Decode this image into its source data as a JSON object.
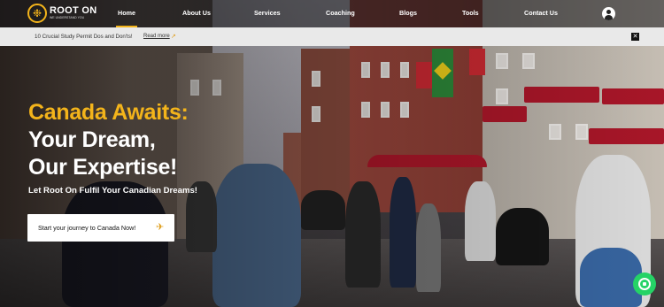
{
  "brand": {
    "name": "ROOT ON",
    "tagline": "WE UNDERSTAND YOU",
    "accent_color": "#f3b41b",
    "logo_icon": "maple-leaf-icon"
  },
  "nav": {
    "items": [
      {
        "label": "Home",
        "active": true
      },
      {
        "label": "About Us",
        "active": false
      },
      {
        "label": "Services",
        "active": false
      },
      {
        "label": "Coaching",
        "active": false
      },
      {
        "label": "Blogs",
        "active": false
      },
      {
        "label": "Tools",
        "active": false
      },
      {
        "label": "Contact Us",
        "active": false
      }
    ],
    "account_icon": "user-account-icon"
  },
  "announcement": {
    "text": "10 Crucial Study Permit Dos and Don'ts!",
    "link_label": "Read more",
    "link_icon": "arrow-up-right-icon",
    "close_icon": "close-icon"
  },
  "hero": {
    "headline_accent": "Canada Awaits:",
    "headline_line2": "Your Dream,",
    "headline_line3": "Our Expertise!",
    "subheadline": "Let Root On Fulfil Your Canadian Dreams!",
    "cta_label": "Start your journey to Canada Now!",
    "cta_icon": "airplane-icon"
  },
  "floating": {
    "whatsapp_icon": "whatsapp-icon",
    "whatsapp_color": "#25d366"
  }
}
